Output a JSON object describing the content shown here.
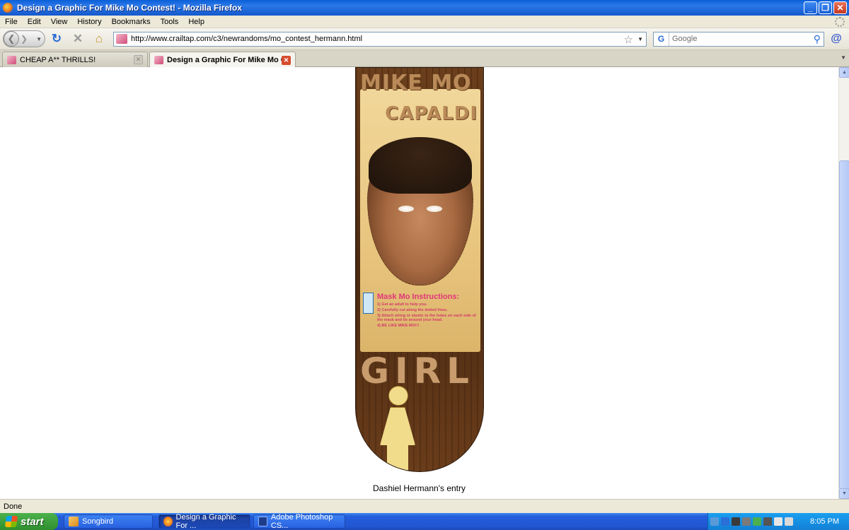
{
  "window": {
    "title": "Design a Graphic For Mike Mo Contest! - Mozilla Firefox",
    "buttons": {
      "minimize": "_",
      "maximize": "❐",
      "close": "✕"
    }
  },
  "menu": {
    "items": [
      "File",
      "Edit",
      "View",
      "History",
      "Bookmarks",
      "Tools",
      "Help"
    ]
  },
  "nav": {
    "url": "http://www.crailtap.com/c3/newrandoms/mo_contest_hermann.html",
    "search_placeholder": "Google",
    "search_engine_letter": "G"
  },
  "tabs": [
    {
      "label": "CHEAP A** THRILLS!",
      "active": false
    },
    {
      "label": "Design a Graphic For Mike Mo Co...",
      "active": true
    }
  ],
  "content": {
    "deck": {
      "headline_line1": "MIKE MO",
      "headline_line2": "CAPALDI",
      "instructions_title": "Mask Mo Instructions:",
      "instructions": [
        "1) Get an adult to help you.",
        "2) Carefully cut along the dotted lines.",
        "3) Attach string or elastic to the holes on each side of the mask and tie around your head.",
        "4) BE LIKE MIKE MO!!!"
      ],
      "brand": "GIRL"
    },
    "caption": "Dashiel Hermann's entry"
  },
  "status": {
    "text": "Done"
  },
  "taskbar": {
    "start_label": "start",
    "tasks": [
      {
        "label": "Songbird",
        "active": false
      },
      {
        "label": "Design a Graphic For ...",
        "active": true
      },
      {
        "label": "Adobe Photoshop CS...",
        "active": false
      }
    ],
    "clock": "8:05 PM"
  },
  "colors": {
    "titlebar": "#2b78e8",
    "chrome": "#ece9d8",
    "taskbar": "#245edb",
    "start_button": "#3c9a3c",
    "instructions_pink": "#e0367a"
  }
}
